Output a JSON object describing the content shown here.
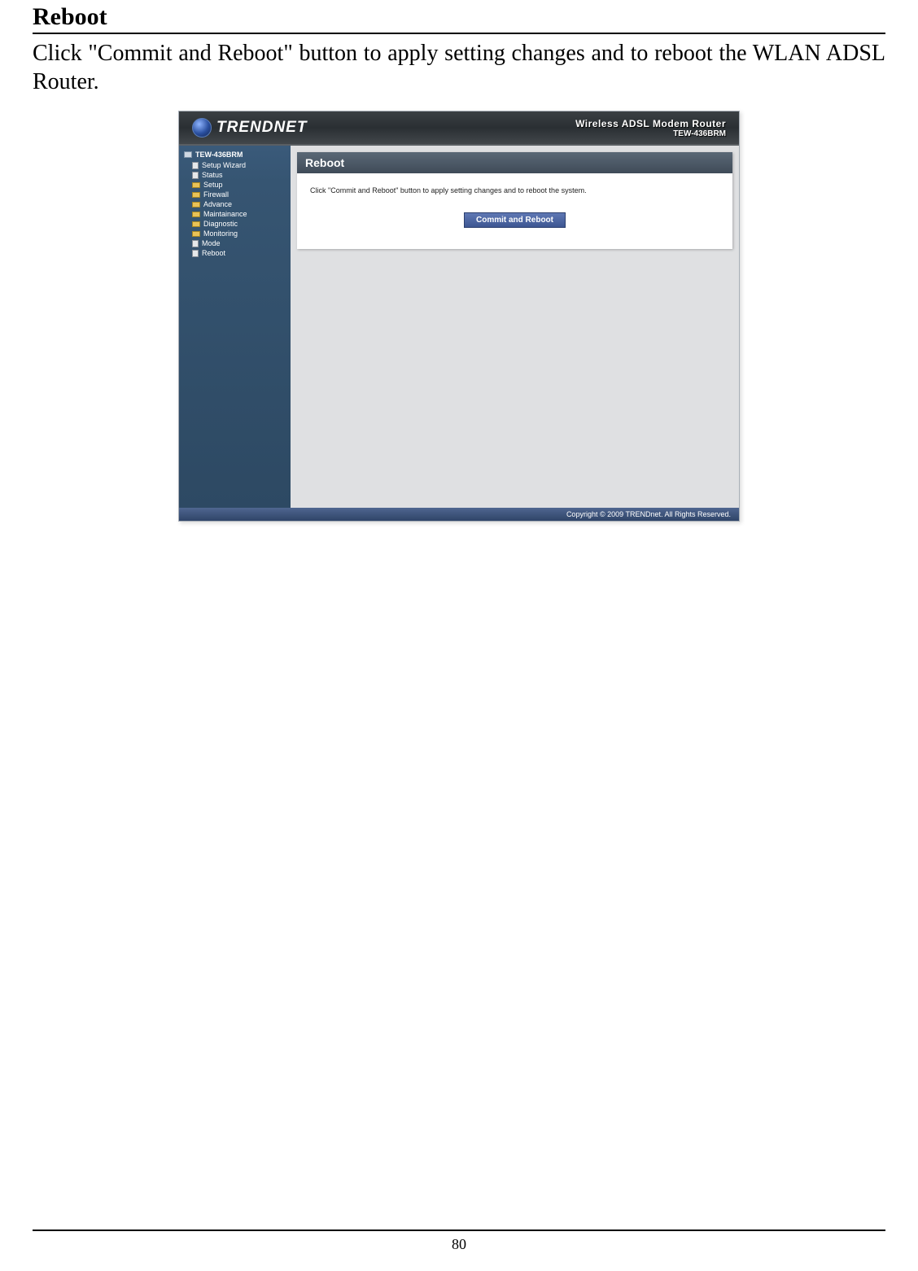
{
  "doc": {
    "heading": "Reboot",
    "body": "Click \"Commit and Reboot\" button to apply setting changes and to reboot the WLAN ADSL Router.",
    "page_number": "80"
  },
  "router": {
    "brand_text": "TRENDNET",
    "header_line1": "Wireless ADSL Modem Router",
    "header_line2": "TEW-436BRM",
    "nav": {
      "root": "TEW-436BRM",
      "items": [
        {
          "label": "Setup Wizard",
          "icon": "file"
        },
        {
          "label": "Status",
          "icon": "file"
        },
        {
          "label": "Setup",
          "icon": "folder"
        },
        {
          "label": "Firewall",
          "icon": "folder"
        },
        {
          "label": "Advance",
          "icon": "folder"
        },
        {
          "label": "Maintainance",
          "icon": "folder"
        },
        {
          "label": "Diagnostic",
          "icon": "folder"
        },
        {
          "label": "Monitoring",
          "icon": "folder"
        },
        {
          "label": "Mode",
          "icon": "file"
        },
        {
          "label": "Reboot",
          "icon": "file"
        }
      ]
    },
    "panel": {
      "title": "Reboot",
      "desc": "Click \"Commit and Reboot\" button to apply setting changes and to reboot the system.",
      "button": "Commit and Reboot"
    },
    "footer": "Copyright © 2009 TRENDnet. All Rights Reserved."
  }
}
